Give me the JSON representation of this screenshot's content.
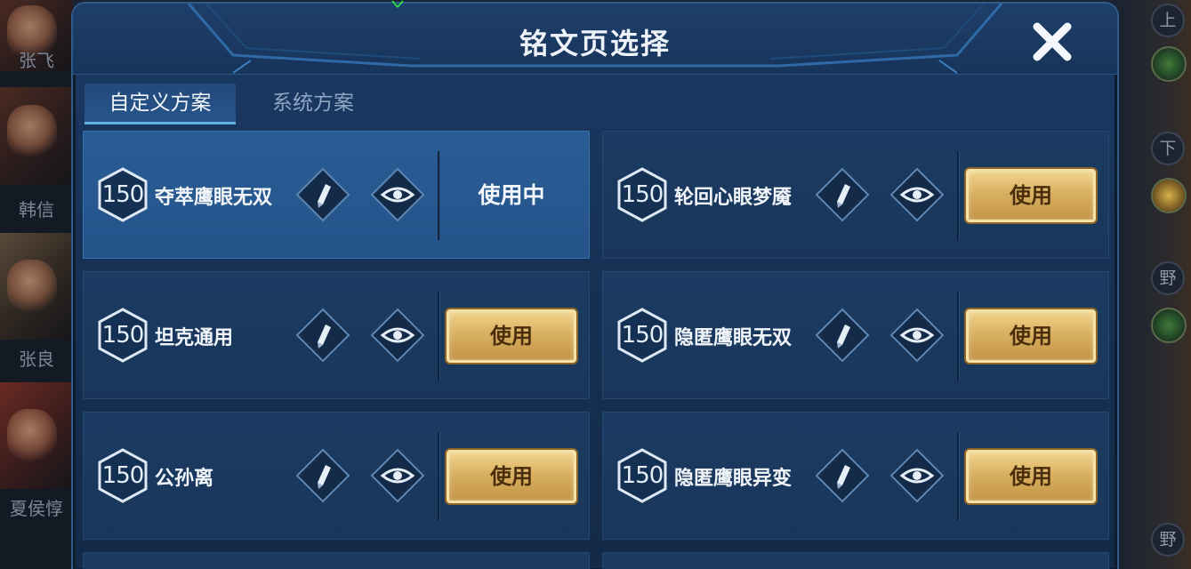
{
  "dialog": {
    "title": "铭文页选择"
  },
  "tabs": [
    {
      "label": "自定义方案",
      "active": true
    },
    {
      "label": "系统方案",
      "active": false
    }
  ],
  "pages": [
    {
      "level": "150",
      "name": "夺萃鹰眼无双",
      "status": "使用中",
      "selected": true
    },
    {
      "level": "150",
      "name": "轮回心眼梦魇",
      "action": "使用",
      "selected": false
    },
    {
      "level": "150",
      "name": "坦克通用",
      "action": "使用",
      "selected": false
    },
    {
      "level": "150",
      "name": "隐匿鹰眼无双",
      "action": "使用",
      "selected": false
    },
    {
      "level": "150",
      "name": "公孙离",
      "action": "使用",
      "selected": false
    },
    {
      "level": "150",
      "name": "隐匿鹰眼异变",
      "action": "使用",
      "selected": false
    }
  ],
  "left_heroes": [
    "张飞",
    "韩信",
    "张良",
    "夏侯惇"
  ],
  "right_lanes": [
    "上",
    "下",
    "野",
    "野"
  ],
  "colors": {
    "accent_gold": "#d9b062",
    "panel_blue": "#1c3b62",
    "selected_blue": "#2a5d95",
    "tab_underline": "#5fb1e6"
  },
  "icons": {
    "level_badge": "hexagon-level-icon",
    "edit": "pencil-diamond-icon",
    "preview": "eye-diamond-icon",
    "close": "close-x-icon"
  }
}
